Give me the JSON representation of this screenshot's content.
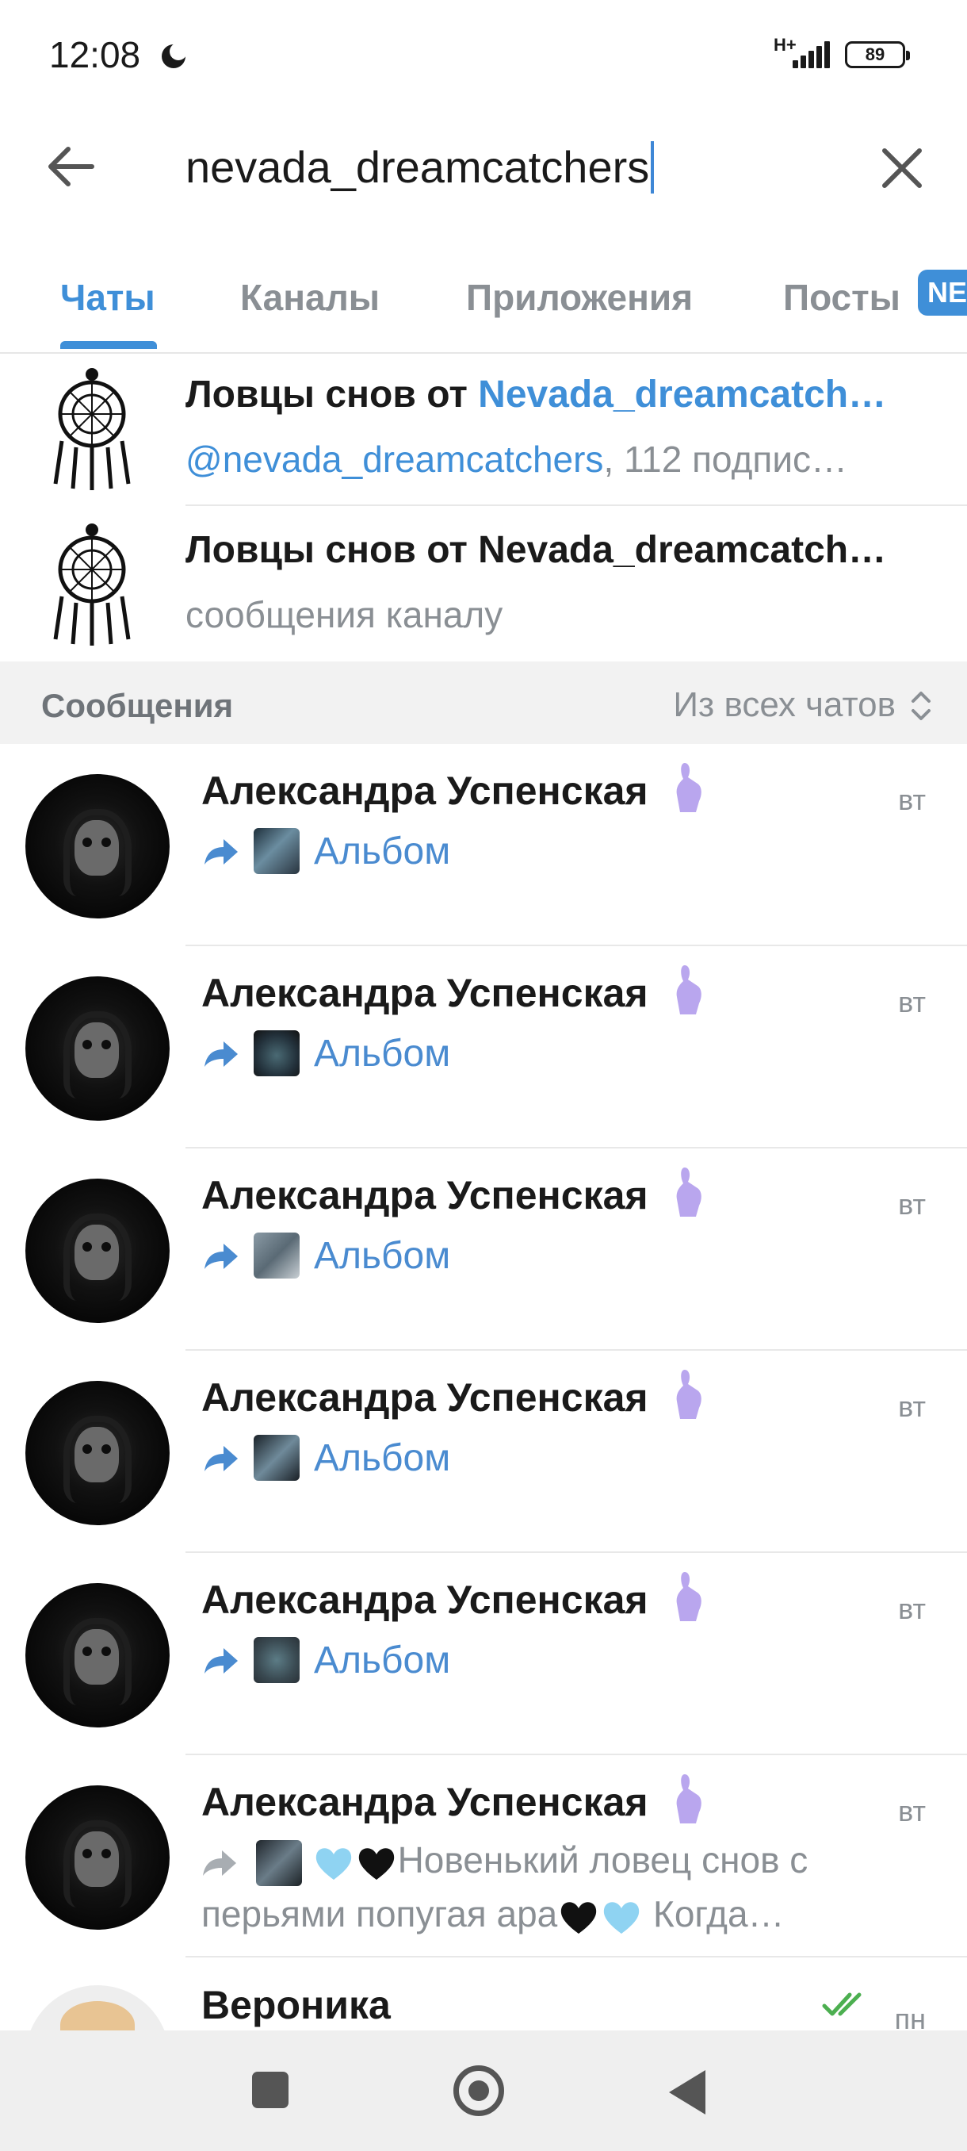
{
  "status_bar": {
    "time": "12:08",
    "network": "H+",
    "battery": "89"
  },
  "search": {
    "query": "nevada_dreamcatchers"
  },
  "tabs": [
    {
      "label": "Чаты"
    },
    {
      "label": "Каналы"
    },
    {
      "label": "Приложения"
    },
    {
      "label": "Посты"
    }
  ],
  "new_badge": "NE",
  "channels": [
    {
      "title_prefix": "Ловцы снов от ",
      "title_highlight": "Nevada_dreamcatch…",
      "subtitle_highlight": "@nevada_dreamcatchers",
      "subtitle_rest": ", 112 подпис…"
    },
    {
      "title": "Ловцы снов от Nevada_dreamcatch…",
      "subtitle": "сообщения каналу"
    }
  ],
  "messages_section": {
    "label": "Сообщения",
    "filter": "Из всех чатов"
  },
  "messages": [
    {
      "name": "Александра Успенская",
      "time": "вт",
      "text": "Альбом"
    },
    {
      "name": "Александра Успенская",
      "time": "вт",
      "text": "Альбом"
    },
    {
      "name": "Александра Успенская",
      "time": "вт",
      "text": "Альбом"
    },
    {
      "name": "Александра Успенская",
      "time": "вт",
      "text": "Альбом"
    },
    {
      "name": "Александра Успенская",
      "time": "вт",
      "text": "Альбом"
    },
    {
      "name": "Александра Успенская",
      "time": "вт",
      "preview_part1": "Новенький ловец снов с перьями попугая ара",
      "preview_part2": "  Когда…"
    }
  ],
  "last_chat": {
    "name": "Вероника",
    "time": "пн"
  },
  "icons": {
    "back": "arrow-left-icon",
    "clear": "close-icon",
    "sort": "chevron-up-down-icon",
    "forward": "forward-arrow-icon",
    "emoji": "finger-heart-emoji-icon",
    "read": "double-check-icon"
  },
  "colors": {
    "accent": "#3f8fd8",
    "muted": "#8a8f94",
    "check": "#4caf50"
  }
}
